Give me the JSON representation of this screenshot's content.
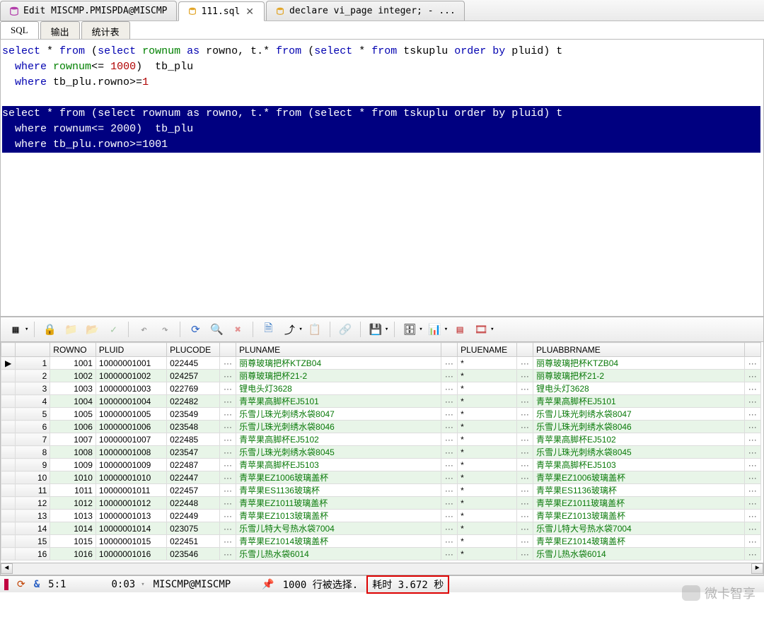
{
  "tabs": [
    {
      "label": "Edit MISCMP.PMISPDA@MISCMP",
      "active": false,
      "hasClose": false
    },
    {
      "label": "111.sql",
      "active": true,
      "hasClose": true
    },
    {
      "label": "declare vi_page integer; - ...",
      "active": false,
      "hasClose": false
    }
  ],
  "sub_tabs": [
    {
      "label": "SQL",
      "active": true
    },
    {
      "label": "输出",
      "active": false
    },
    {
      "label": "统计表",
      "active": false
    }
  ],
  "sql": {
    "block1": [
      {
        "segments": [
          {
            "t": "select",
            "c": "blue"
          },
          {
            "t": " * ",
            "c": ""
          },
          {
            "t": "from",
            "c": "blue"
          },
          {
            "t": " (",
            "c": ""
          },
          {
            "t": "select",
            "c": "blue"
          },
          {
            "t": " ",
            "c": ""
          },
          {
            "t": "rownum",
            "c": "green"
          },
          {
            "t": " ",
            "c": ""
          },
          {
            "t": "as",
            "c": "blue"
          },
          {
            "t": " rowno, t.* ",
            "c": ""
          },
          {
            "t": "from",
            "c": "blue"
          },
          {
            "t": " (",
            "c": ""
          },
          {
            "t": "select",
            "c": "blue"
          },
          {
            "t": " * ",
            "c": ""
          },
          {
            "t": "from",
            "c": "blue"
          },
          {
            "t": " tskuplu ",
            "c": ""
          },
          {
            "t": "order by",
            "c": "blue"
          },
          {
            "t": " pluid) t",
            "c": ""
          }
        ]
      },
      {
        "segments": [
          {
            "t": "  ",
            "c": ""
          },
          {
            "t": "where",
            "c": "blue"
          },
          {
            "t": " ",
            "c": ""
          },
          {
            "t": "rownum",
            "c": "green"
          },
          {
            "t": "<= ",
            "c": ""
          },
          {
            "t": "1000",
            "c": "red"
          },
          {
            "t": ")  tb_plu",
            "c": ""
          }
        ]
      },
      {
        "segments": [
          {
            "t": "  ",
            "c": ""
          },
          {
            "t": "where",
            "c": "blue"
          },
          {
            "t": " tb_plu.rowno>=",
            "c": ""
          },
          {
            "t": "1",
            "c": "red"
          }
        ]
      }
    ],
    "block2": [
      {
        "segments": [
          {
            "t": "select",
            "c": "blue"
          },
          {
            "t": " * ",
            "c": ""
          },
          {
            "t": "from",
            "c": "blue"
          },
          {
            "t": " (",
            "c": ""
          },
          {
            "t": "select",
            "c": "blue"
          },
          {
            "t": " ",
            "c": ""
          },
          {
            "t": "rownum",
            "c": "green"
          },
          {
            "t": " ",
            "c": ""
          },
          {
            "t": "as",
            "c": "blue"
          },
          {
            "t": " rowno, t.* ",
            "c": ""
          },
          {
            "t": "from",
            "c": "blue"
          },
          {
            "t": " (",
            "c": ""
          },
          {
            "t": "select",
            "c": "blue"
          },
          {
            "t": " * ",
            "c": ""
          },
          {
            "t": "from",
            "c": "blue"
          },
          {
            "t": " tskuplu ",
            "c": ""
          },
          {
            "t": "order by",
            "c": "blue"
          },
          {
            "t": " pluid) t",
            "c": ""
          }
        ]
      },
      {
        "segments": [
          {
            "t": "  ",
            "c": ""
          },
          {
            "t": "where",
            "c": "blue"
          },
          {
            "t": " ",
            "c": ""
          },
          {
            "t": "rownum",
            "c": "green"
          },
          {
            "t": "<= ",
            "c": ""
          },
          {
            "t": "2000",
            "c": "red"
          },
          {
            "t": ")  tb_plu",
            "c": ""
          }
        ]
      },
      {
        "segments": [
          {
            "t": "  ",
            "c": ""
          },
          {
            "t": "where",
            "c": "blue"
          },
          {
            "t": " tb_plu.rowno>=",
            "c": ""
          },
          {
            "t": "1001",
            "c": "red"
          }
        ]
      }
    ]
  },
  "grid": {
    "headers": [
      "",
      "",
      "ROWNO",
      "PLUID",
      "PLUCODE",
      "",
      "PLUNAME",
      "",
      "PLUENAME",
      "",
      "PLUABBRNAME",
      ""
    ],
    "rows": [
      {
        "n": 1,
        "rowno": 1001,
        "pluid": "10000001001",
        "plucode": "022445",
        "pluname": "丽尊玻璃把杯KTZB04",
        "pluename": "*",
        "pluabbr": "丽尊玻璃把杯KTZB04"
      },
      {
        "n": 2,
        "rowno": 1002,
        "pluid": "10000001002",
        "plucode": "024257",
        "pluname": "丽尊玻璃把杯21-2",
        "pluename": "*",
        "pluabbr": "丽尊玻璃把杯21-2"
      },
      {
        "n": 3,
        "rowno": 1003,
        "pluid": "10000001003",
        "plucode": "022769",
        "pluname": "锂电头灯3628",
        "pluename": "*",
        "pluabbr": "锂电头灯3628"
      },
      {
        "n": 4,
        "rowno": 1004,
        "pluid": "10000001004",
        "plucode": "022482",
        "pluname": "青苹果高脚杯EJ5101",
        "pluename": "*",
        "pluabbr": "青苹果高脚杯EJ5101"
      },
      {
        "n": 5,
        "rowno": 1005,
        "pluid": "10000001005",
        "plucode": "023549",
        "pluname": "乐雪儿珠光刺绣水袋8047",
        "pluename": "*",
        "pluabbr": "乐雪儿珠光刺绣水袋8047"
      },
      {
        "n": 6,
        "rowno": 1006,
        "pluid": "10000001006",
        "plucode": "023548",
        "pluname": "乐雪儿珠光刺绣水袋8046",
        "pluename": "*",
        "pluabbr": "乐雪儿珠光刺绣水袋8046"
      },
      {
        "n": 7,
        "rowno": 1007,
        "pluid": "10000001007",
        "plucode": "022485",
        "pluname": "青苹果高脚杯EJ5102",
        "pluename": "*",
        "pluabbr": "青苹果高脚杯EJ5102"
      },
      {
        "n": 8,
        "rowno": 1008,
        "pluid": "10000001008",
        "plucode": "023547",
        "pluname": "乐雪儿珠光刺绣水袋8045",
        "pluename": "*",
        "pluabbr": "乐雪儿珠光刺绣水袋8045"
      },
      {
        "n": 9,
        "rowno": 1009,
        "pluid": "10000001009",
        "plucode": "022487",
        "pluname": "青苹果高脚杯EJ5103",
        "pluename": "*",
        "pluabbr": "青苹果高脚杯EJ5103"
      },
      {
        "n": 10,
        "rowno": 1010,
        "pluid": "10000001010",
        "plucode": "022447",
        "pluname": "青苹果EZ1006玻璃盖杯",
        "pluename": "*",
        "pluabbr": "青苹果EZ1006玻璃盖杯"
      },
      {
        "n": 11,
        "rowno": 1011,
        "pluid": "10000001011",
        "plucode": "022457",
        "pluname": "青苹果ES1136玻璃杯",
        "pluename": "*",
        "pluabbr": "青苹果ES1136玻璃杯"
      },
      {
        "n": 12,
        "rowno": 1012,
        "pluid": "10000001012",
        "plucode": "022448",
        "pluname": "青苹果EZ1011玻璃盖杯",
        "pluename": "*",
        "pluabbr": "青苹果EZ1011玻璃盖杯"
      },
      {
        "n": 13,
        "rowno": 1013,
        "pluid": "10000001013",
        "plucode": "022449",
        "pluname": "青苹果EZ1013玻璃盖杯",
        "pluename": "*",
        "pluabbr": "青苹果EZ1013玻璃盖杯"
      },
      {
        "n": 14,
        "rowno": 1014,
        "pluid": "10000001014",
        "plucode": "023075",
        "pluname": "乐雪儿特大号热水袋7004",
        "pluename": "*",
        "pluabbr": "乐雪儿特大号热水袋7004"
      },
      {
        "n": 15,
        "rowno": 1015,
        "pluid": "10000001015",
        "plucode": "022451",
        "pluname": "青苹果EZ1014玻璃盖杯",
        "pluename": "*",
        "pluabbr": "青苹果EZ1014玻璃盖杯"
      },
      {
        "n": 16,
        "rowno": 1016,
        "pluid": "10000001016",
        "plucode": "023546",
        "pluname": "乐雪儿热水袋6014",
        "pluename": "*",
        "pluabbr": "乐雪儿热水袋6014"
      }
    ]
  },
  "status": {
    "cursor": "5:1",
    "time": "0:03",
    "connection": "MISCMP@MISCMP",
    "rows_text": "1000 行被选择.",
    "elapsed": "耗时 3.672 秒"
  },
  "watermark": "微卡智享",
  "toolbar_icons": {
    "grid": "▦",
    "lock": "🔒",
    "folder": "📁",
    "folder2": "📂",
    "check": "✓",
    "undo": "↶",
    "redo": "↷",
    "refresh": "⟳",
    "binoc": "🔍",
    "delete": "✖",
    "doc": "🗎",
    "export": "⤴",
    "clipboard": "📋",
    "link": "🔗",
    "save": "💾",
    "db": "🗄",
    "chart": "📊",
    "table": "▤",
    "film": "🎞"
  }
}
